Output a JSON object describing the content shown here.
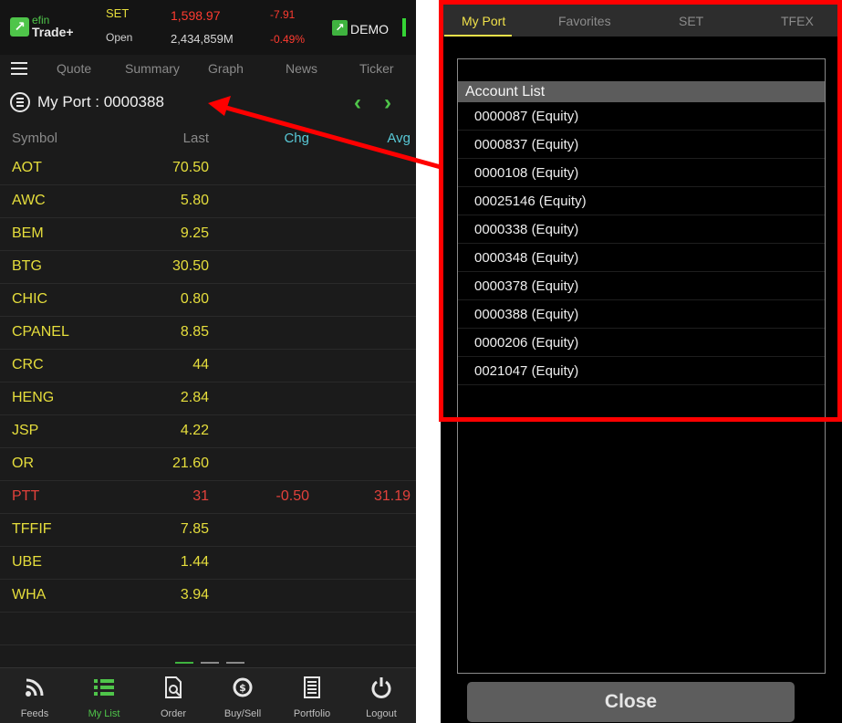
{
  "header": {
    "logo_line1_a": "efin",
    "logo_line2": "Trade+",
    "market": "SET",
    "market_status": "Open",
    "index_value": "1,598.97",
    "volume": "2,434,859M",
    "index_change": "-7.91",
    "index_change_pct": "-0.49%",
    "demo_label": "DEMO"
  },
  "nav": {
    "items": [
      "Quote",
      "Summary",
      "Graph",
      "News",
      "Ticker"
    ]
  },
  "port": {
    "title": "My Port : 0000388"
  },
  "columns": {
    "symbol": "Symbol",
    "last": "Last",
    "chg": "Chg",
    "avg": "Avg"
  },
  "rows": [
    {
      "symbol": "AOT",
      "last": "70.50",
      "chg": "",
      "avg": ""
    },
    {
      "symbol": "AWC",
      "last": "5.80",
      "chg": "",
      "avg": ""
    },
    {
      "symbol": "BEM",
      "last": "9.25",
      "chg": "",
      "avg": ""
    },
    {
      "symbol": "BTG",
      "last": "30.50",
      "chg": "",
      "avg": ""
    },
    {
      "symbol": "CHIC",
      "last": "0.80",
      "chg": "",
      "avg": ""
    },
    {
      "symbol": "CPANEL",
      "last": "8.85",
      "chg": "",
      "avg": ""
    },
    {
      "symbol": "CRC",
      "last": "44",
      "chg": "",
      "avg": ""
    },
    {
      "symbol": "HENG",
      "last": "2.84",
      "chg": "",
      "avg": ""
    },
    {
      "symbol": "JSP",
      "last": "4.22",
      "chg": "",
      "avg": ""
    },
    {
      "symbol": "OR",
      "last": "21.60",
      "chg": "",
      "avg": ""
    },
    {
      "symbol": "PTT",
      "last": "31",
      "chg": "-0.50",
      "avg": "31.19"
    },
    {
      "symbol": "TFFIF",
      "last": "7.85",
      "chg": "",
      "avg": ""
    },
    {
      "symbol": "UBE",
      "last": "1.44",
      "chg": "",
      "avg": ""
    },
    {
      "symbol": "WHA",
      "last": "3.94",
      "chg": "",
      "avg": ""
    }
  ],
  "tabbar": [
    {
      "label": "Feeds",
      "icon": "rss-icon"
    },
    {
      "label": "My List",
      "icon": "list-icon"
    },
    {
      "label": "Order",
      "icon": "order-icon"
    },
    {
      "label": "Buy/Sell",
      "icon": "buy-sell-icon"
    },
    {
      "label": "Portfolio",
      "icon": "portfolio-icon"
    },
    {
      "label": "Logout",
      "icon": "power-icon"
    }
  ],
  "right_tabs": [
    "My Port",
    "Favorites",
    "SET",
    "TFEX"
  ],
  "account_list": {
    "title": "Account List",
    "items": [
      "0000087 (Equity)",
      "0000837 (Equity)",
      "0000108 (Equity)",
      "00025146 (Equity)",
      "0000338 (Equity)",
      "0000348 (Equity)",
      "0000378 (Equity)",
      "0000388 (Equity)",
      "0000206 (Equity)",
      "0021047 (Equity)"
    ]
  },
  "close_label": "Close",
  "colors": {
    "accent_green": "#4fc54a",
    "symbol_yellow": "#e6de3c",
    "down_red": "#e2413b",
    "header_red": "#ff3b30",
    "chg_cyan": "#58c8d6",
    "tab_active": "#f0e14a",
    "annotation_red": "#ff0000"
  }
}
